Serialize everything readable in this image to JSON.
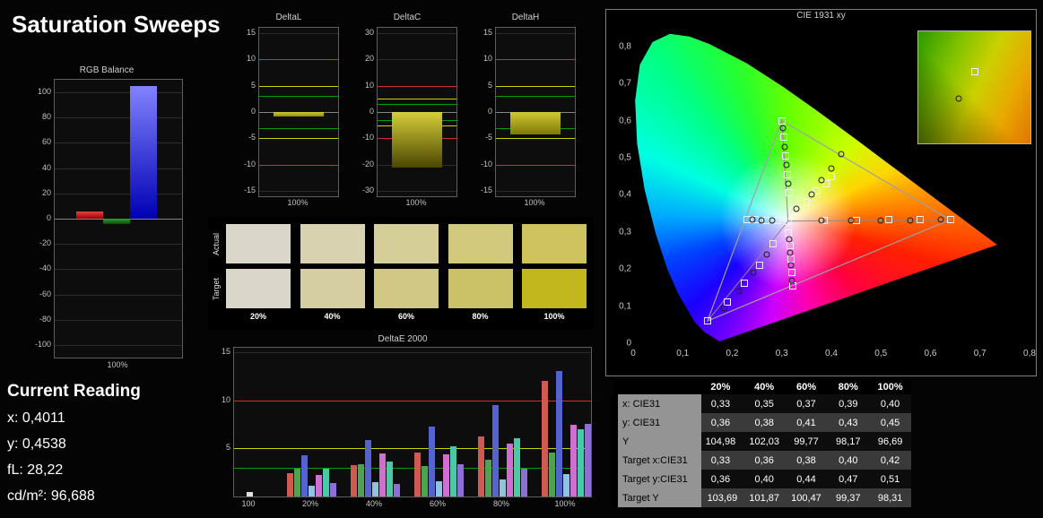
{
  "title": "Saturation Sweeps",
  "current_reading": {
    "title": "Current Reading",
    "lines": [
      "x: 0,4011",
      "y: 0,4538",
      "fL: 28,22",
      "cd/m²: 96,688"
    ]
  },
  "swatches": {
    "row_labels": [
      "Actual",
      "Target"
    ],
    "col_labels": [
      "20%",
      "40%",
      "60%",
      "80%",
      "100%"
    ],
    "actual": [
      "#dad6ca",
      "#d8d2b0",
      "#d5cf97",
      "#d2c97c",
      "#cfc360"
    ],
    "target": [
      "#dad6ca",
      "#d4cea2",
      "#d0c884",
      "#cbc166",
      "#c3b71e"
    ]
  },
  "table": {
    "headers": [
      "",
      "20%",
      "40%",
      "60%",
      "80%",
      "100%"
    ],
    "rows": [
      {
        "label": "x: CIE31",
        "values": [
          "0,33",
          "0,35",
          "0,37",
          "0,39",
          "0,40"
        ]
      },
      {
        "label": "y: CIE31",
        "values": [
          "0,36",
          "0,38",
          "0,41",
          "0,43",
          "0,45"
        ]
      },
      {
        "label": "Y",
        "values": [
          "104,98",
          "102,03",
          "99,77",
          "98,17",
          "96,69"
        ]
      },
      {
        "label": "Target x:CIE31",
        "values": [
          "0,33",
          "0,36",
          "0,38",
          "0,40",
          "0,42"
        ]
      },
      {
        "label": "Target y:CIE31",
        "values": [
          "0,36",
          "0,40",
          "0,44",
          "0,47",
          "0,51"
        ]
      },
      {
        "label": "Target Y",
        "values": [
          "103,69",
          "101,87",
          "100,47",
          "99,37",
          "98,31"
        ]
      }
    ]
  },
  "chart_data": [
    {
      "id": "rgb_balance",
      "type": "bar",
      "title": "RGB Balance",
      "categories": [
        "Red",
        "Green",
        "Blue"
      ],
      "values": [
        6,
        -4,
        105
      ],
      "ylim": [
        -110,
        110
      ],
      "yticks": [
        100,
        80,
        60,
        40,
        20,
        0,
        -20,
        -40,
        -60,
        -80,
        -100
      ],
      "xlabel": "100%",
      "bar_colors": [
        [
          "#e84040",
          "#9c0000"
        ],
        [
          "#2f9e2f",
          "#0b4d0b"
        ],
        [
          "#8282ff",
          "#0000b4"
        ]
      ]
    },
    {
      "id": "delta_l",
      "type": "bar",
      "title": "DeltaL",
      "categories": [
        "100%"
      ],
      "values": [
        -0.8
      ],
      "ylim": [
        -16,
        16
      ],
      "yticks": [
        15,
        10,
        5,
        0,
        -5,
        -10,
        -15
      ],
      "xlabel": "100%",
      "ref_lines": [
        {
          "value": 10,
          "color": "#cf2f2f"
        },
        {
          "value": 5,
          "color": "#cfcf00"
        },
        {
          "value": 3,
          "color": "#00a000"
        }
      ],
      "bar_colors": [
        [
          "#d2ca32",
          "#8f8a0a"
        ]
      ]
    },
    {
      "id": "delta_c",
      "type": "bar",
      "title": "DeltaC",
      "categories": [
        "100%"
      ],
      "values": [
        -21
      ],
      "ylim": [
        -32,
        32
      ],
      "yticks": [
        30,
        20,
        10,
        0,
        -10,
        -20,
        -30
      ],
      "xlabel": "100%",
      "ref_lines": [
        {
          "value": 10,
          "color": "#cf2f2f"
        },
        {
          "value": 5,
          "color": "#cfcf00"
        },
        {
          "value": 3,
          "color": "#00a000"
        }
      ],
      "bar_colors": [
        [
          "#d6cf3a",
          "#4a4600"
        ]
      ]
    },
    {
      "id": "delta_h",
      "type": "bar",
      "title": "DeltaH",
      "categories": [
        "100%"
      ],
      "values": [
        -4.2
      ],
      "ylim": [
        -16,
        16
      ],
      "yticks": [
        15,
        10,
        5,
        0,
        -5,
        -10,
        -15
      ],
      "xlabel": "100%",
      "ref_lines": [
        {
          "value": 10,
          "color": "#cf2f2f"
        },
        {
          "value": 5,
          "color": "#cfcf00"
        },
        {
          "value": 3,
          "color": "#00a000"
        }
      ],
      "bar_colors": [
        [
          "#d2ca32",
          "#7d780a"
        ]
      ]
    },
    {
      "id": "deltae2000",
      "type": "bar",
      "title": "DeltaE 2000",
      "ylim": [
        0,
        15.5
      ],
      "yticks": [
        5,
        10,
        15
      ],
      "ref_lines": [
        {
          "value": 3,
          "color": "#00a000"
        },
        {
          "value": 5,
          "color": "#cfcf00"
        },
        {
          "value": 10,
          "color": "#cf2f2f"
        }
      ],
      "series_colors": [
        "#cf5a52",
        "#4fa24f",
        "#5563cf",
        "#8fc3e0",
        "#cf6fcf",
        "#49c9a4",
        "#8e6fd8"
      ],
      "groups": [
        {
          "label": "100",
          "values": [
            0.5
          ],
          "colors": [
            "#e0e0e0"
          ]
        },
        {
          "label": "20%",
          "values": [
            2.4,
            2.9,
            4.3,
            1.1,
            2.2,
            2.9,
            1.4
          ]
        },
        {
          "label": "40%",
          "values": [
            3.3,
            3.4,
            5.9,
            1.5,
            4.5,
            3.6,
            1.3
          ]
        },
        {
          "label": "60%",
          "values": [
            4.6,
            3.2,
            7.3,
            1.6,
            4.4,
            5.2,
            3.4
          ]
        },
        {
          "label": "80%",
          "values": [
            6.3,
            3.8,
            9.5,
            1.8,
            5.5,
            6.1,
            2.9
          ]
        },
        {
          "label": "100%",
          "values": [
            12.0,
            4.6,
            13.1,
            2.3,
            7.5,
            7.0,
            7.6
          ]
        }
      ]
    },
    {
      "id": "cie1931",
      "type": "scatter",
      "title": "CIE 1931 xy",
      "xlim": [
        0,
        0.8
      ],
      "ylim": [
        0,
        0.85
      ],
      "xtick_values": [
        0,
        0.1,
        0.2,
        0.3,
        0.4,
        0.5,
        0.6,
        0.7,
        0.8
      ],
      "xtick_labels": [
        "0",
        "0,1",
        "0,2",
        "0,3",
        "0,4",
        "0,5",
        "0,6",
        "0,7",
        "0,8"
      ],
      "ytick_values": [
        0,
        0.1,
        0.2,
        0.3,
        0.4,
        0.5,
        0.6,
        0.7,
        0.8
      ],
      "ytick_labels": [
        "0",
        "0,1",
        "0,2",
        "0,3",
        "0,4",
        "0,5",
        "0,6",
        "0,7",
        "0,8"
      ],
      "triangle": [
        [
          0.64,
          0.333
        ],
        [
          0.3,
          0.6
        ],
        [
          0.15,
          0.06
        ]
      ],
      "white_point": [
        0.3127,
        0.329
      ],
      "squares": [
        [
          0.3127,
          0.329
        ],
        [
          0.64,
          0.333
        ],
        [
          0.3,
          0.6
        ],
        [
          0.15,
          0.06
        ],
        [
          0.385,
          0.332
        ],
        [
          0.45,
          0.332
        ],
        [
          0.515,
          0.333
        ],
        [
          0.58,
          0.333
        ],
        [
          0.315,
          0.405
        ],
        [
          0.312,
          0.455
        ],
        [
          0.308,
          0.505
        ],
        [
          0.304,
          0.555
        ],
        [
          0.283,
          0.268
        ],
        [
          0.255,
          0.21
        ],
        [
          0.225,
          0.162
        ],
        [
          0.19,
          0.112
        ],
        [
          0.33,
          0.36
        ],
        [
          0.35,
          0.38
        ],
        [
          0.37,
          0.41
        ],
        [
          0.39,
          0.43
        ],
        [
          0.4,
          0.45
        ],
        [
          0.292,
          0.331
        ],
        [
          0.268,
          0.332
        ],
        [
          0.247,
          0.333
        ],
        [
          0.23,
          0.334
        ],
        [
          0.314,
          0.298
        ],
        [
          0.316,
          0.263
        ],
        [
          0.318,
          0.228
        ],
        [
          0.32,
          0.19
        ],
        [
          0.322,
          0.155
        ]
      ],
      "circles": [
        [
          0.38,
          0.331
        ],
        [
          0.44,
          0.331
        ],
        [
          0.5,
          0.332
        ],
        [
          0.56,
          0.332
        ],
        [
          0.62,
          0.333
        ],
        [
          0.33,
          0.363
        ],
        [
          0.36,
          0.4
        ],
        [
          0.38,
          0.44
        ],
        [
          0.4,
          0.47
        ],
        [
          0.42,
          0.51
        ],
        [
          0.313,
          0.43
        ],
        [
          0.309,
          0.48
        ],
        [
          0.306,
          0.53
        ],
        [
          0.302,
          0.58
        ],
        [
          0.27,
          0.24
        ],
        [
          0.243,
          0.19
        ],
        [
          0.213,
          0.14
        ],
        [
          0.183,
          0.095
        ],
        [
          0.28,
          0.331
        ],
        [
          0.258,
          0.332
        ],
        [
          0.24,
          0.333
        ],
        [
          0.315,
          0.28
        ],
        [
          0.317,
          0.245
        ],
        [
          0.319,
          0.21
        ],
        [
          0.321,
          0.17
        ]
      ],
      "inset": {
        "square": [
          50,
          36
        ],
        "circle": [
          36,
          60
        ]
      }
    }
  ]
}
